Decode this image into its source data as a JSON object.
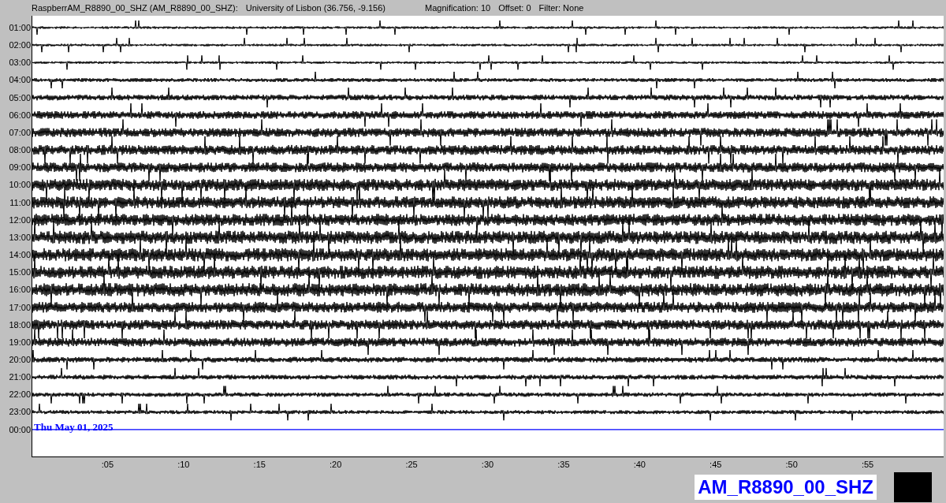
{
  "header": {
    "channel": "RaspberrAM_R8890_00_SHZ (AM_R8890_00_SHZ):",
    "location": "University of Lisbon (36.756, -9.156)",
    "magnification": "Magnification: 10",
    "offset": "Offset: 0",
    "filter": "Filter: None"
  },
  "hour_labels": [
    "01:00",
    "02:00",
    "03:00",
    "04:00",
    "05:00",
    "06:00",
    "07:00",
    "08:00",
    "09:00",
    "10:00",
    "11:00",
    "12:00",
    "13:00",
    "14:00",
    "15:00",
    "16:00",
    "17:00",
    "18:00",
    "19:00",
    "20:00",
    "21:00",
    "22:00",
    "23:00",
    "00:00"
  ],
  "date_label": "Thu May 01, 2025",
  "x_ticks": [
    ":05",
    ":10",
    ":15",
    ":20",
    ":25",
    ":30",
    ":35",
    ":40",
    ":45",
    ":50",
    ":55"
  ],
  "station_label": "AM_R8890_00_SHZ"
}
